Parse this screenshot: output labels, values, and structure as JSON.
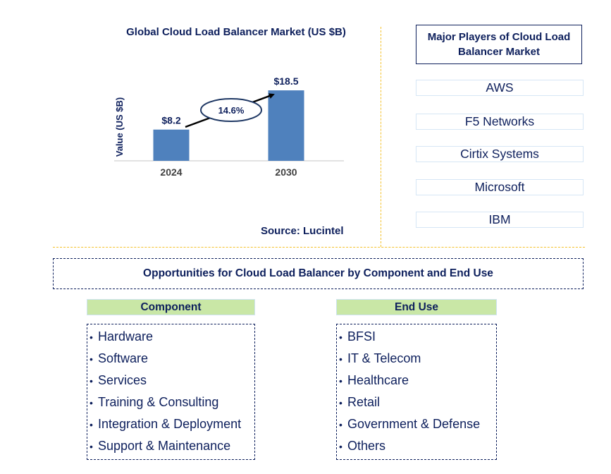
{
  "chart_data": {
    "type": "bar",
    "title": "Global Cloud Load Balancer Market (US $B)",
    "xlabel": "",
    "ylabel": "Value (US $B)",
    "categories": [
      "2024",
      "2030"
    ],
    "values": [
      8.2,
      18.5
    ],
    "data_labels": [
      "$8.2",
      "$18.5"
    ],
    "ylim": [
      0,
      20
    ],
    "grid": false,
    "bar_color": "#4f81bd",
    "annotation": {
      "text": "14.6%",
      "type": "CAGR arrow",
      "from": "2024",
      "to": "2030"
    }
  },
  "source": "Source: Lucintel",
  "players": {
    "title": "Major Players of Cloud Load Balancer Market",
    "items": [
      "AWS",
      "F5 Networks",
      "Cirtix Systems",
      "Microsoft",
      "IBM"
    ]
  },
  "opportunities": {
    "title": "Opportunities for Cloud Load Balancer by Component and End Use",
    "component": {
      "heading": "Component",
      "items": [
        "Hardware",
        "Software",
        "Services",
        "Training & Consulting",
        "Integration & Deployment",
        "Support & Maintenance"
      ]
    },
    "end_use": {
      "heading": "End Use",
      "items": [
        "BFSI",
        "IT & Telecom",
        "Healthcare",
        "Retail",
        "Government & Defense",
        "Others"
      ]
    }
  },
  "colors": {
    "text": "#0d1f5c",
    "bar": "#4f81bd",
    "divider": "#f5c22b",
    "header_fill": "#c9e7a6",
    "player_border": "#d6e6f5"
  }
}
